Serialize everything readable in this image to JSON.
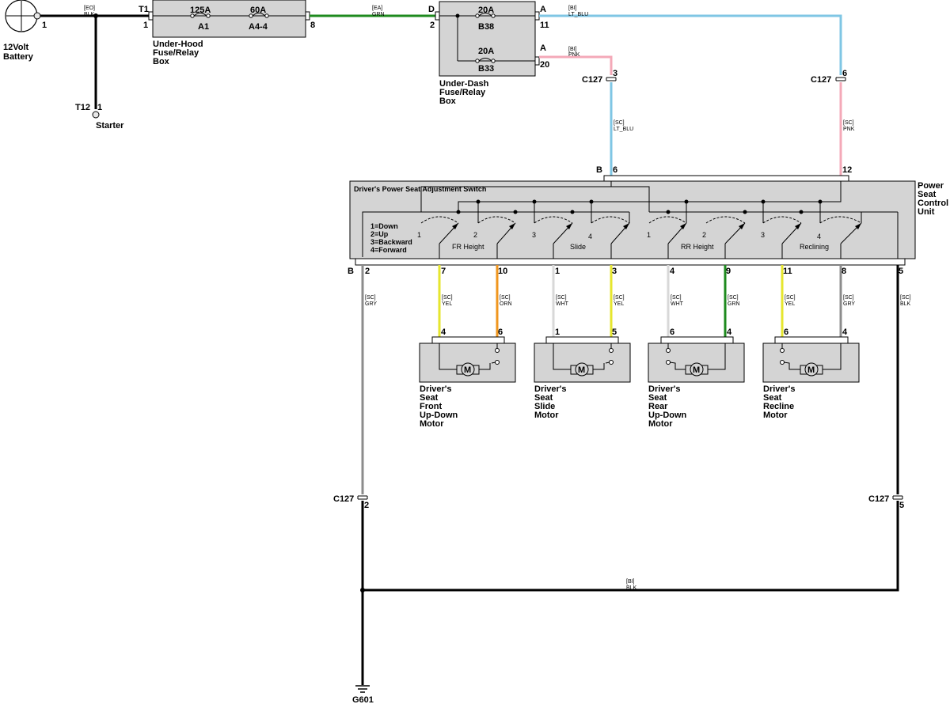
{
  "battery": {
    "label_line1": "12Volt",
    "label_line2": "Battery",
    "pin": "1"
  },
  "starter": {
    "connector": "T12",
    "pin": "1",
    "label": "Starter"
  },
  "underhood": {
    "label_lines": [
      "Under-Hood",
      "Fuse/Relay",
      "Box"
    ],
    "conn_in": "T1",
    "pin_in": "1",
    "pin_out": "8",
    "fuses": [
      {
        "rating": "125A",
        "id": "A1"
      },
      {
        "rating": "60A",
        "id": "A4-4"
      }
    ]
  },
  "underdash": {
    "label_lines": [
      "Under-Dash",
      "Fuse/Relay",
      "Box"
    ],
    "conn_in": "D",
    "pin_in": "2",
    "fuses": [
      {
        "rating": "20A",
        "id": "B38",
        "conn": "A",
        "pin": "11"
      },
      {
        "rating": "20A",
        "id": "B33",
        "conn": "A",
        "pin": "20"
      }
    ]
  },
  "wires": {
    "w_bat": {
      "code": "[EO]",
      "color": "BLK"
    },
    "w_grn": {
      "code": "[EA]",
      "color": "GRN"
    },
    "w_ltblu": {
      "code": "[BI]",
      "color": "LT_BLU"
    },
    "w_pnk": {
      "code": "[BI]",
      "color": "PNK"
    },
    "w_sc_ltblu": {
      "code": "[SC]",
      "color": "LT_BLU"
    },
    "w_sc_pnk": {
      "code": "[SC]",
      "color": "PNK"
    },
    "w_gnd": {
      "code": "[BI]",
      "color": "BLK"
    }
  },
  "c127": {
    "name": "C127",
    "pin3": "3",
    "pin6": "6",
    "pin2": "2",
    "pin5": "5"
  },
  "control_unit": {
    "label_lines": [
      "Power",
      "Seat",
      "Control",
      "Unit"
    ],
    "switch_title": "Driver's Power Seat Adjustment Switch",
    "conn_top": "B",
    "pin_top_left": "6",
    "pin_top_right": "12",
    "conn_bottom": "B",
    "legend": [
      "1=Down",
      "2=Up",
      "3=Backward",
      "4=Forward"
    ],
    "groups": [
      "FR Height",
      "Slide",
      "RR Height",
      "Reclining"
    ],
    "switch_numbers": [
      "1",
      "2",
      "3",
      "4"
    ]
  },
  "bottom_wires": [
    {
      "pin": "2",
      "code": "[SC]",
      "color": "GRY"
    },
    {
      "pin": "7",
      "code": "[SC]",
      "color": "YEL"
    },
    {
      "pin": "10",
      "code": "[SC]",
      "color": "ORN"
    },
    {
      "pin": "1",
      "code": "[SC]",
      "color": "WHT"
    },
    {
      "pin": "3",
      "code": "[SC]",
      "color": "YEL"
    },
    {
      "pin": "4",
      "code": "[SC]",
      "color": "WHT"
    },
    {
      "pin": "9",
      "code": "[SC]",
      "color": "GRN"
    },
    {
      "pin": "11",
      "code": "[SC]",
      "color": "YEL"
    },
    {
      "pin": "8",
      "code": "[SC]",
      "color": "GRY"
    },
    {
      "pin": "5",
      "code": "[SC]",
      "color": "BLK"
    }
  ],
  "motors": [
    {
      "label_lines": [
        "Driver's",
        "Seat",
        "Front",
        "Up-Down",
        "Motor"
      ],
      "pin_left": "4",
      "pin_right": "6"
    },
    {
      "label_lines": [
        "Driver's",
        "Seat",
        "Slide",
        "Motor"
      ],
      "pin_left": "1",
      "pin_right": "5"
    },
    {
      "label_lines": [
        "Driver's",
        "Seat",
        "Rear",
        "Up-Down",
        "Motor"
      ],
      "pin_left": "6",
      "pin_right": "4"
    },
    {
      "label_lines": [
        "Driver's",
        "Seat",
        "Recline",
        "Motor"
      ],
      "pin_left": "6",
      "pin_right": "4"
    }
  ],
  "motor_symbol": "M",
  "ground": {
    "label": "G601"
  },
  "colors": {
    "BLK": "#000000",
    "GRN": "#1e8a1e",
    "LT_BLU": "#7fc6e4",
    "PNK": "#f4a9b8",
    "GRY": "#8c8c8c",
    "YEL": "#e6e62e",
    "ORN": "#f0961e",
    "WHT": "#d8d8d8",
    "box_fill": "#d4d4d4"
  }
}
